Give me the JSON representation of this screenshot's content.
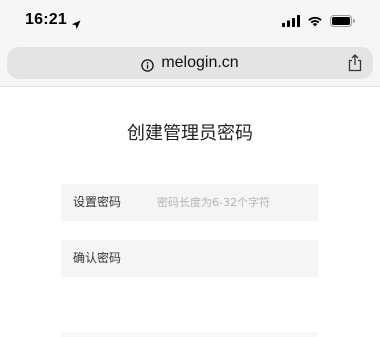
{
  "status_bar": {
    "time": "16:21",
    "icons": [
      "location-arrow-icon",
      "cellular-signal-icon",
      "wifi-icon",
      "battery-icon"
    ]
  },
  "browser": {
    "url": "melogin.cn",
    "icons": [
      "info-icon",
      "share-icon"
    ]
  },
  "page": {
    "title": "创建管理员密码",
    "fields": [
      {
        "label": "设置密码",
        "placeholder": "密码长度为6-32个字符",
        "value": ""
      },
      {
        "label": "确认密码",
        "placeholder": "",
        "value": ""
      }
    ]
  }
}
